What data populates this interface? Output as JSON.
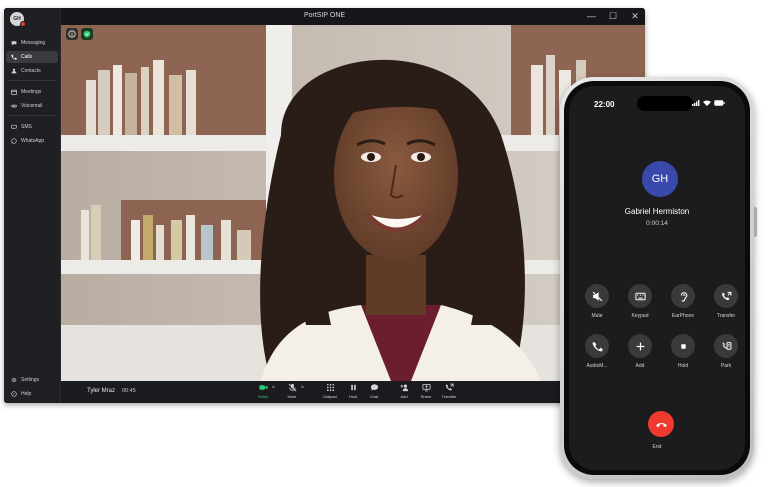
{
  "window": {
    "title": "PortSIP ONE",
    "controls": {
      "minimize": "—",
      "maximize": "☐",
      "close": "✕"
    }
  },
  "user": {
    "initials": "GH"
  },
  "sidebar": {
    "items": [
      {
        "label": "Messaging",
        "icon": "chat-bubble-icon"
      },
      {
        "label": "Calls",
        "icon": "phone-icon"
      },
      {
        "label": "Contacts",
        "icon": "person-icon"
      },
      {
        "label": "Meetings",
        "icon": "calendar-icon"
      },
      {
        "label": "Voicemail",
        "icon": "voicemail-icon"
      },
      {
        "label": "SMS",
        "icon": "sms-icon"
      },
      {
        "label": "WhatsApp",
        "icon": "whatsapp-icon"
      }
    ],
    "footer": [
      {
        "label": "Settings",
        "icon": "gear-icon"
      },
      {
        "label": "Help",
        "icon": "help-icon"
      }
    ]
  },
  "call": {
    "name": "Tyler Mraz",
    "duration": "00:45",
    "controls": [
      {
        "label": "Video",
        "icon": "video-camera-icon"
      },
      {
        "label": "Mute",
        "icon": "microphone-muted-icon"
      },
      {
        "label": "Dialpad",
        "icon": "dialpad-icon"
      },
      {
        "label": "Hold",
        "icon": "pause-icon"
      },
      {
        "label": "Chat",
        "icon": "chat-bubble-icon"
      },
      {
        "label": "Add",
        "icon": "add-person-icon"
      },
      {
        "label": "Share",
        "icon": "screen-share-icon"
      },
      {
        "label": "Transfer",
        "icon": "transfer-icon"
      }
    ]
  },
  "phone": {
    "time": "22:00",
    "avatar_initials": "GH",
    "contact_name": "Gabriel Hermiston",
    "duration": "0:00:14",
    "buttons": [
      {
        "label": "Mute",
        "icon": "speaker-muted-icon"
      },
      {
        "label": "Keypad",
        "icon": "keyboard-icon"
      },
      {
        "label": "EarPhone",
        "icon": "ear-icon"
      },
      {
        "label": "Transfer",
        "icon": "transfer-icon"
      },
      {
        "label": "AudioM...",
        "icon": "phone-icon"
      },
      {
        "label": "Add",
        "icon": "plus-icon"
      },
      {
        "label": "Hold",
        "icon": "stop-icon"
      },
      {
        "label": "Park",
        "icon": "park-icon"
      }
    ],
    "end_label": "End"
  },
  "colors": {
    "accent_green": "#2ecc71",
    "end_red": "#f03a2f",
    "avatar_blue": "#3949ab"
  }
}
